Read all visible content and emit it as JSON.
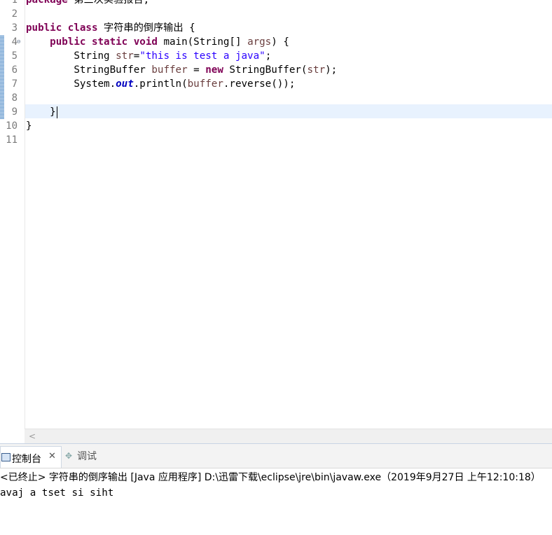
{
  "editor": {
    "line_numbers": [
      "1",
      "2",
      "3",
      "4",
      "5",
      "6",
      "7",
      "8",
      "9",
      "10",
      "11"
    ],
    "fold_marker": "⊖",
    "lines": {
      "l1": {
        "kw": "package",
        "rest": " 第三次实验报告;"
      },
      "l3": {
        "kw1": "public",
        "kw2": "class",
        "rest": " 字符串的倒序输出 {"
      },
      "l4": {
        "kw1": "public",
        "kw2": "static",
        "kw3": "void",
        "name": " main(String[] ",
        "param": "args",
        "rest": ") {"
      },
      "l5": {
        "type": "String ",
        "var": "str",
        "eq": "=",
        "str": "\"this is test a java\"",
        "end": ";"
      },
      "l6": {
        "type": "StringBuffer ",
        "var": "buffer",
        "eq": " = ",
        "kw": "new",
        "ctor": " StringBuffer(",
        "arg": "str",
        "end": ");"
      },
      "l7": {
        "pre": "System.",
        "field": "out",
        "mid": ".println(",
        "var": "buffer",
        "end": ".reverse());"
      },
      "l9": {
        "text": "}"
      },
      "l10": {
        "text": "}"
      }
    }
  },
  "scrollbar": {
    "left_arrow": "<"
  },
  "console": {
    "tabs": [
      {
        "label": "控制台",
        "close": "✕"
      },
      {
        "label": "调试"
      }
    ],
    "debug_icon": "✥",
    "status": "<已终止> 字符串的倒序输出 [Java 应用程序] D:\\迅雷下载\\eclipse\\jre\\bin\\javaw.exe（2019年9月27日 上午12:10:18）",
    "output": "avaj a tset si siht"
  },
  "colors": {
    "keyword": "#7f0055",
    "string": "#2a00ff",
    "variable": "#6a3e3e",
    "field": "#0000c0",
    "current_line": "#e8f2fe"
  }
}
